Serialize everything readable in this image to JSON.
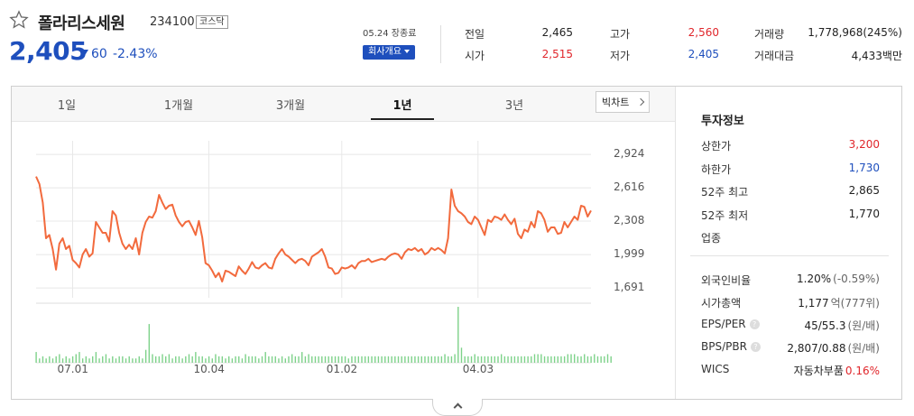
{
  "stock": {
    "name": "폴라리스세원",
    "code": "234100",
    "market": "코스닥",
    "price": "2,405",
    "change": "60",
    "change_pct": "-2.43%",
    "date_label": "05.24 장종료",
    "company_button": "회사개요"
  },
  "quote": [
    {
      "label": "전일",
      "value": "2,465",
      "color": "default"
    },
    {
      "label": "고가",
      "value": "2,560",
      "color": "red"
    },
    {
      "label": "거래량",
      "value": "1,778,968(245%)",
      "color": "default"
    },
    {
      "label": "시가",
      "value": "2,515",
      "color": "red"
    },
    {
      "label": "저가",
      "value": "2,405",
      "color": "blue"
    },
    {
      "label": "거래대금",
      "value": "4,433백만",
      "color": "default"
    }
  ],
  "tabs": [
    "1일",
    "1개월",
    "3개월",
    "1년",
    "3년"
  ],
  "active_tab": "1년",
  "bigchart_label": "빅차트",
  "investment": {
    "title": "투자정보",
    "group1": [
      {
        "label": "상한가",
        "value": "3,200",
        "color": "red"
      },
      {
        "label": "하한가",
        "value": "1,730",
        "color": "blue"
      },
      {
        "label": "52주 최고",
        "value": "2,865",
        "color": "default"
      },
      {
        "label": "52주 최저",
        "value": "1,770",
        "color": "default"
      },
      {
        "label": "업종",
        "value": "",
        "color": "default"
      }
    ],
    "group2": [
      {
        "label": "외국인비율",
        "value": "1.20%",
        "extra": "(-0.59%)",
        "color": "default",
        "help": false
      },
      {
        "label": "시가총액",
        "value": "1,177",
        "extra": "억(777위)",
        "color": "default",
        "help": false
      },
      {
        "label": "EPS/PER",
        "value": "45/55.3",
        "extra": "(원/배)",
        "color": "default",
        "help": true
      },
      {
        "label": "BPS/PBR",
        "value": "2,807/0.88",
        "extra": "(원/배)",
        "color": "default",
        "help": true
      },
      {
        "label": "WICS",
        "value": "자동차부품",
        "extra": "0.16%",
        "color": "red-extra",
        "help": false
      }
    ]
  },
  "colors": {
    "line": "#f26a3d",
    "volume": "#7ed28a",
    "up": "#e0262b",
    "down": "#1e4fbd",
    "grid": "#e8e8e8"
  },
  "chart_data": {
    "type": "line",
    "ylim": [
      1600,
      3050
    ],
    "yticks": [
      "2,924",
      "2,616",
      "2,308",
      "1,999",
      "1,691"
    ],
    "ytick_values": [
      2924,
      2616,
      2308,
      1999,
      1691
    ],
    "xticks": [
      "07.01",
      "10.04",
      "01.02",
      "04.03"
    ],
    "xtick_index": [
      11,
      52,
      92,
      133
    ],
    "price": [
      2720,
      2650,
      2480,
      2150,
      2180,
      2050,
      1860,
      2100,
      2150,
      2050,
      2080,
      1950,
      1920,
      1880,
      2000,
      2050,
      1980,
      2010,
      2300,
      2250,
      2200,
      2200,
      2120,
      2400,
      2360,
      2200,
      2100,
      2050,
      2090,
      2050,
      2150,
      2000,
      2200,
      2300,
      2350,
      2340,
      2400,
      2550,
      2480,
      2420,
      2450,
      2460,
      2360,
      2300,
      2260,
      2300,
      2310,
      2250,
      2180,
      2310,
      2160,
      1920,
      1900,
      1850,
      1790,
      1830,
      1750,
      1850,
      1840,
      1820,
      1800,
      1890,
      1850,
      1820,
      1870,
      1930,
      1880,
      1870,
      1900,
      1920,
      1880,
      1870,
      1960,
      2010,
      2050,
      2000,
      1980,
      1950,
      1920,
      1950,
      1960,
      1940,
      1900,
      1980,
      2000,
      2020,
      2050,
      1980,
      1880,
      1870,
      1820,
      1830,
      1880,
      1870,
      1880,
      1900,
      1870,
      1920,
      1940,
      1940,
      1960,
      1930,
      1940,
      1950,
      1960,
      1950,
      1980,
      2000,
      2010,
      2000,
      1960,
      2020,
      2050,
      2040,
      2060,
      2030,
      2050,
      2000,
      2020,
      2060,
      2040,
      2060,
      2040,
      2010,
      2150,
      2600,
      2450,
      2400,
      2380,
      2350,
      2300,
      2280,
      2350,
      2320,
      2250,
      2180,
      2320,
      2300,
      2350,
      2340,
      2320,
      2370,
      2320,
      2280,
      2330,
      2190,
      2150,
      2230,
      2210,
      2300,
      2250,
      2400,
      2380,
      2320,
      2210,
      2250,
      2250,
      2190,
      2200,
      2300,
      2250,
      2300,
      2350,
      2320,
      2450,
      2440,
      2350,
      2405
    ],
    "volume": [
      5,
      2,
      3,
      2,
      3,
      2,
      3,
      4,
      2,
      3,
      2,
      3,
      4,
      5,
      2,
      3,
      2,
      3,
      5,
      2,
      3,
      4,
      2,
      3,
      2,
      3,
      3,
      2,
      3,
      2,
      2,
      3,
      2,
      6,
      18,
      4,
      3,
      3,
      4,
      3,
      4,
      2,
      3,
      3,
      2,
      3,
      4,
      3,
      5,
      3,
      3,
      2,
      3,
      2,
      4,
      3,
      3,
      2,
      3,
      2,
      3,
      3,
      2,
      4,
      3,
      3,
      3,
      2,
      3,
      5,
      3,
      3,
      3,
      2,
      3,
      2,
      3,
      4,
      3,
      3,
      5,
      3,
      4,
      3,
      3,
      3,
      3,
      3,
      3,
      3,
      3,
      3,
      3,
      3,
      2,
      3,
      3,
      3,
      3,
      3,
      3,
      3,
      3,
      3,
      3,
      3,
      3,
      3,
      3,
      3,
      3,
      3,
      3,
      3,
      3,
      3,
      3,
      3,
      3,
      3,
      3,
      3,
      3,
      4,
      3,
      3,
      4,
      26,
      7,
      3,
      3,
      3,
      4,
      3,
      3,
      3,
      3,
      3,
      3,
      3,
      4,
      3,
      3,
      3,
      3,
      3,
      3,
      3,
      3,
      3,
      4,
      4,
      4,
      3,
      3,
      3,
      3,
      3,
      3,
      3,
      4,
      4,
      4,
      3,
      3,
      4,
      3,
      3,
      4,
      3,
      3,
      3,
      4,
      3
    ]
  }
}
